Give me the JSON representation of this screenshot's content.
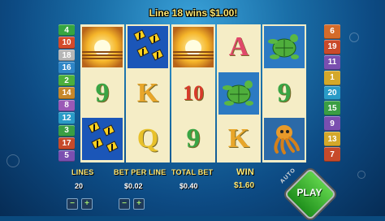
{
  "message": "Line 18 wins $1.00!",
  "left_lines": [
    {
      "num": "4",
      "color": "#36a542"
    },
    {
      "num": "10",
      "color": "#d44a2a"
    },
    {
      "num": "18",
      "color": "#b6b6b6"
    },
    {
      "num": "16",
      "color": "#2f86c7"
    },
    {
      "num": "2",
      "color": "#4caf3d"
    },
    {
      "num": "14",
      "color": "#c7872a"
    },
    {
      "num": "8",
      "color": "#9b59b6"
    },
    {
      "num": "12",
      "color": "#2a9bc7"
    },
    {
      "num": "3",
      "color": "#3a9e44"
    },
    {
      "num": "17",
      "color": "#c74a2a"
    },
    {
      "num": "5",
      "color": "#7a4fb0"
    }
  ],
  "right_lines": [
    {
      "num": "6",
      "color": "#d46b2a"
    },
    {
      "num": "19",
      "color": "#c94a2a"
    },
    {
      "num": "11",
      "color": "#7a4fb0"
    },
    {
      "num": "1",
      "color": "#d4a82a"
    },
    {
      "num": "20",
      "color": "#2a9bc7"
    },
    {
      "num": "15",
      "color": "#3a9e44"
    },
    {
      "num": "9",
      "color": "#7a4fb0"
    },
    {
      "num": "13",
      "color": "#d4a82a"
    },
    {
      "num": "7",
      "color": "#c74a2a"
    }
  ],
  "reels": [
    [
      {
        "symbol": "sunset"
      },
      {
        "symbol": "9",
        "color": "#3aa545"
      },
      {
        "symbol": "fish"
      }
    ],
    [
      {
        "symbol": "fish"
      },
      {
        "symbol": "K",
        "color": "#e8a62a"
      },
      {
        "symbol": "Q",
        "color": "#e8c12a"
      }
    ],
    [
      {
        "symbol": "sunset"
      },
      {
        "symbol": "10",
        "color": "#d83a2a"
      },
      {
        "symbol": "9",
        "color": "#3aa545"
      }
    ],
    [
      {
        "symbol": "A",
        "color": "#e0486a"
      },
      {
        "symbol": "turtle"
      },
      {
        "symbol": "K",
        "color": "#e8a62a"
      }
    ],
    [
      {
        "symbol": "turtle"
      },
      {
        "symbol": "9",
        "color": "#3aa545"
      },
      {
        "symbol": "octopus"
      }
    ]
  ],
  "panel": {
    "lines_label": "LINES",
    "lines_value": "20",
    "bet_label": "BET PER LINE",
    "bet_value": "$0.02",
    "total_label": "TOTAL BET",
    "total_value": "$0.40",
    "win_label": "WIN",
    "win_value": "$1.60",
    "minus": "−",
    "plus": "+"
  },
  "buttons": {
    "auto_label": "AUTO",
    "play_label": "PLAY"
  }
}
